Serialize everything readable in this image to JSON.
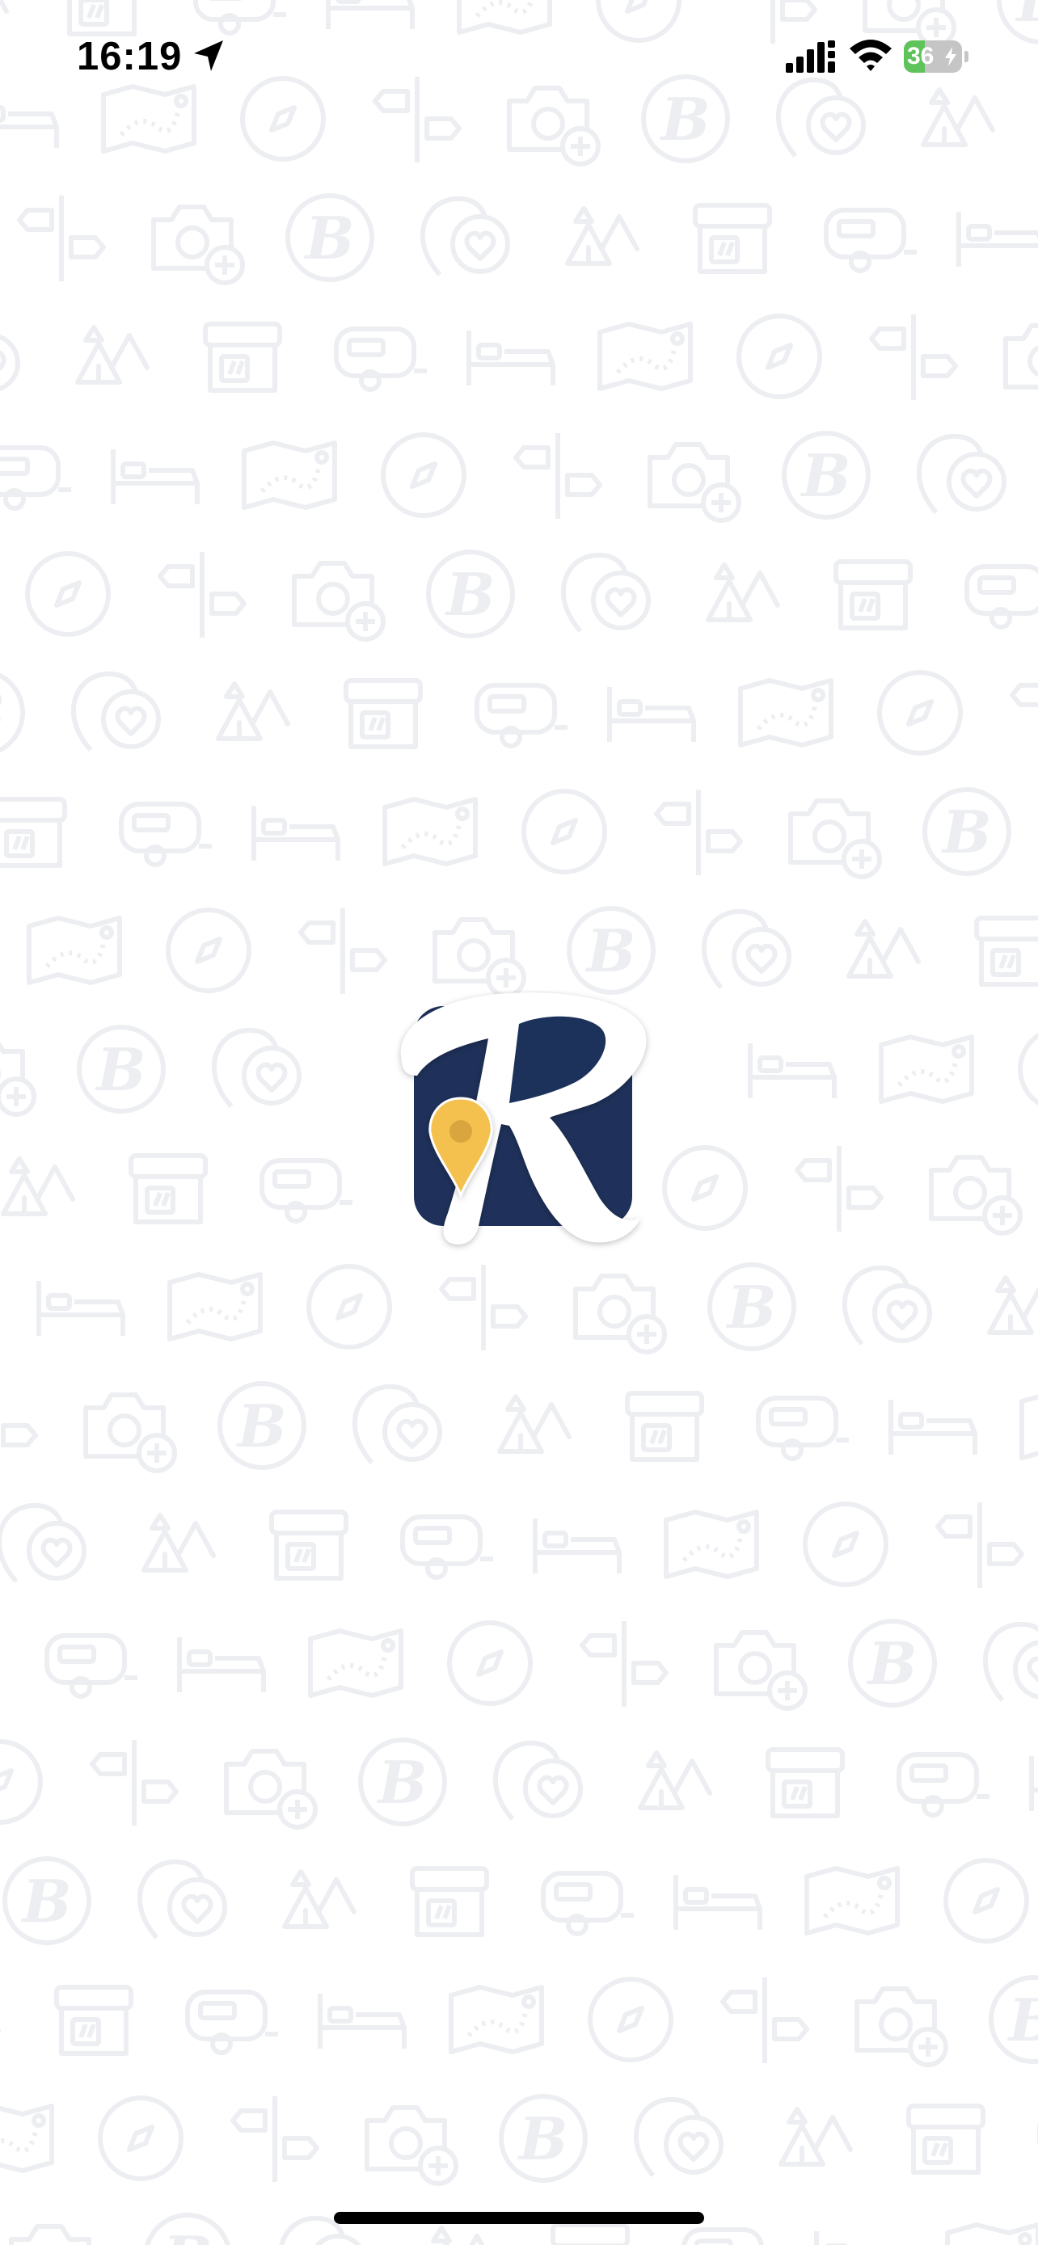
{
  "status_bar": {
    "time": "16:19",
    "battery_level": "36",
    "battery_fraction": 0.36,
    "icons": [
      "location-arrow-icon",
      "cellular-signal-icon",
      "wifi-icon",
      "battery-charging-icon"
    ]
  },
  "splash": {
    "logo_icon": "roadtrippers-r-logo-icon",
    "background_pattern_icons": [
      "camp-tent-icon",
      "storefront-icon",
      "camper-trailer-icon",
      "bed-icon",
      "folded-map-icon",
      "compass-icon",
      "signpost-icon",
      "camera-plus-icon",
      "r-badge-icon",
      "heart-pin-icon"
    ]
  },
  "colors": {
    "logo_navy": "#1f315a",
    "pin_yellow": "#f4c150",
    "pattern_gray": "#eceef1",
    "battery_green": "#5ec35a"
  }
}
